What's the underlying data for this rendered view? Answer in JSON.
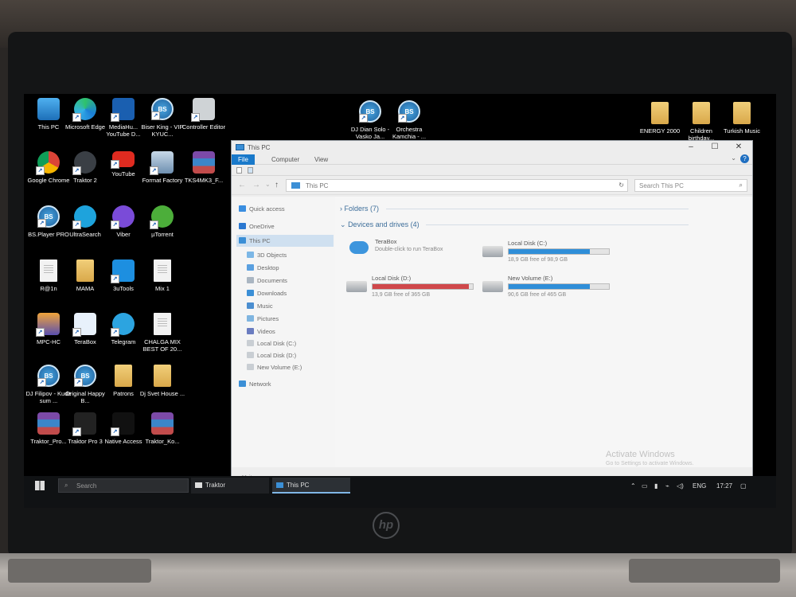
{
  "desktop": {
    "icons": [
      {
        "label": "This PC",
        "icon": "this-pc-icon"
      },
      {
        "label": "Microsoft Edge",
        "icon": "edge-icon"
      },
      {
        "label": "MediaHu... YouTube D...",
        "icon": "mediahuman-icon"
      },
      {
        "label": "Biser King - VIP KYUC...",
        "icon": "bsplayer-icon"
      },
      {
        "label": "Controller Editor",
        "icon": "controller-editor-icon"
      },
      {
        "label": "DJ Dian Solo - Vasko Ja...",
        "icon": "bsplayer-icon"
      },
      {
        "label": "Orchestra Kamchia - ...",
        "icon": "bsplayer-icon"
      },
      {
        "label": "ENERGY 2000",
        "icon": "folder-icon"
      },
      {
        "label": "Children birthday...",
        "icon": "folder-icon"
      },
      {
        "label": "Turkish Music",
        "icon": "folder-icon"
      },
      {
        "label": "Google Chrome",
        "icon": "chrome-icon"
      },
      {
        "label": "Traktor 2",
        "icon": "traktor-icon"
      },
      {
        "label": "YouTube",
        "icon": "youtube-icon"
      },
      {
        "label": "Format Factory",
        "icon": "format-factory-icon"
      },
      {
        "label": "TKS4MK3_F...",
        "icon": "winrar-icon"
      },
      {
        "label": "BS.Player PRO",
        "icon": "bsplayer-icon"
      },
      {
        "label": "UltraSearch",
        "icon": "ultrasearch-icon"
      },
      {
        "label": "Viber",
        "icon": "viber-icon"
      },
      {
        "label": "µTorrent",
        "icon": "utorrent-icon"
      },
      {
        "label": "R@1n",
        "icon": "document-icon"
      },
      {
        "label": "MAMA",
        "icon": "folder-icon"
      },
      {
        "label": "3uTools",
        "icon": "3utools-icon"
      },
      {
        "label": "Mix 1",
        "icon": "document-icon"
      },
      {
        "label": "MPC-HC",
        "icon": "mpc-hc-icon"
      },
      {
        "label": "TeraBox",
        "icon": "terabox-icon"
      },
      {
        "label": "Telegram",
        "icon": "telegram-icon"
      },
      {
        "label": "CHALGA MIX BEST OF 20...",
        "icon": "document-icon"
      },
      {
        "label": "DJ Filipov - Kude sum ...",
        "icon": "bsplayer-icon"
      },
      {
        "label": "Original Happy B...",
        "icon": "bsplayer-icon"
      },
      {
        "label": "Patrons",
        "icon": "folder-icon"
      },
      {
        "label": "Dj Svet House ...",
        "icon": "folder-icon"
      },
      {
        "label": "Traktor_Pro...",
        "icon": "winrar-icon"
      },
      {
        "label": "Traktor Pro 3",
        "icon": "traktor-pro3-icon"
      },
      {
        "label": "Native Access",
        "icon": "native-access-icon"
      },
      {
        "label": "Traktor_Ko...",
        "icon": "winrar-icon"
      }
    ]
  },
  "explorer": {
    "title": "This PC",
    "tabs": {
      "file": "File",
      "computer": "Computer",
      "view": "View"
    },
    "address": "This PC",
    "search_placeholder": "Search This PC",
    "nav": [
      {
        "label": "Quick access"
      },
      {
        "label": "OneDrive"
      },
      {
        "label": "This PC"
      },
      {
        "label": "3D Objects"
      },
      {
        "label": "Desktop"
      },
      {
        "label": "Documents"
      },
      {
        "label": "Downloads"
      },
      {
        "label": "Music"
      },
      {
        "label": "Pictures"
      },
      {
        "label": "Videos"
      },
      {
        "label": "Local Disk (C:)"
      },
      {
        "label": "Local Disk (D:)"
      },
      {
        "label": "New Volume (E:)"
      },
      {
        "label": "Network"
      }
    ],
    "folders_group": "Folders (7)",
    "devices_group": "Devices and drives (4)",
    "terabox": {
      "name": "TeraBox",
      "desc": "Double-click to run TeraBox"
    },
    "drives": [
      {
        "name": "Local Disk (C:)",
        "free": "18,9 GB free of 98,9 GB",
        "used_fraction": 0.81,
        "color": "#2f8ed8"
      },
      {
        "name": "Local Disk (D:)",
        "free": "13,9 GB free of 365 GB",
        "used_fraction": 0.96,
        "color": "#d0484b"
      },
      {
        "name": "New Volume (E:)",
        "free": "90,6 GB free of 465 GB",
        "used_fraction": 0.81,
        "color": "#2f8ed8"
      }
    ],
    "status": "11 items",
    "activate_title": "Activate Windows",
    "activate_sub": "Go to Settings to activate Windows."
  },
  "taskbar": {
    "search_placeholder": "Search",
    "apps": [
      {
        "label": "Traktor"
      },
      {
        "label": "This PC"
      }
    ],
    "language": "ENG",
    "time": "17:27"
  }
}
